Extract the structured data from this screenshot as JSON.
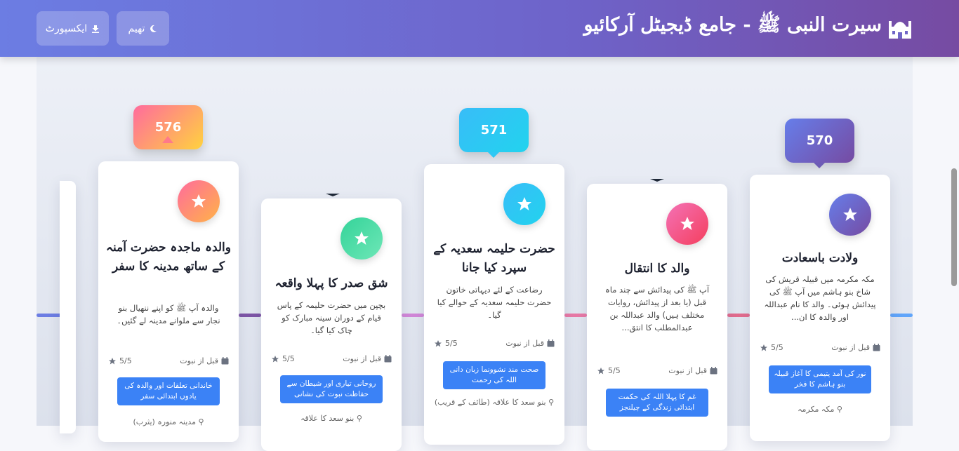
{
  "header": {
    "title": "سیرت النبی ﷺ - جامع ڈیجیٹل آرکائیو",
    "logo_icon": "mosque-icon",
    "export_label": "ایکسپورٹ",
    "theme_label": "تھیم",
    "gradient": [
      "#667eea",
      "#764ba2"
    ]
  },
  "timeline": {
    "cards": [
      {
        "year": "576",
        "title": "والدہ ماجدہ حضرت آمنہ کے ساتھ مدینہ کا سفر",
        "description": "والدہ آپ ﷺ کو اپنے ننھیال بنو نجار سے ملوانے مدینہ لے گئیں۔",
        "period": "قبل از نبوت",
        "rating": "5/5",
        "tag": "خاندانی تعلقات اور والدہ کی یادوں ابتدائی سفر",
        "location": "مدینہ منورہ (یثرب)"
      },
      {
        "year": "",
        "title": "شق صدر کا پہلا واقعہ",
        "description": "بچپن میں حضرت حلیمہ کے پاس قیام کے دوران سینہ مبارک کو چاک کیا گیا۔",
        "period": "قبل از نبوت",
        "rating": "5/5",
        "tag": "روحانی تیاری اور شیطان سے حفاظت نبوت کی نشانی",
        "location": "بنو سعد کا علاقہ"
      },
      {
        "year": "571",
        "title": "حضرت حلیمہ سعدیہ کے سپرد کیا جانا",
        "description": "رضاعت کے لئے دیہاتی خاتون حضرت حلیمہ سعدیہ کے حوالے کیا گیا۔",
        "period": "قبل از نبوت",
        "rating": "5/5",
        "tag": "صحت مند نشوونما زبان دانی اللہ کی رحمت",
        "location": "بنو سعد کا علاقہ (طائف کے قریب)"
      },
      {
        "year": "",
        "title": "والد کا انتقال",
        "description": "آپ ﷺ کی پیدائش سے چند ماہ قبل (یا بعد از پیدائش، روایات مختلف ہیں) والد عبداللہ بن عبدالمطلب کا انتق...",
        "period": "قبل از نبوت",
        "rating": "5/5",
        "tag": "غم کا پہلا اللہ کی حکمت ابتدائی زندگی کے چیلنجز",
        "location": ""
      },
      {
        "year": "570",
        "title": "ولادت باسعادت",
        "description": "مکہ مکرمہ میں قبیلہ قریش کی شاخ بنو ہاشم میں آپ ﷺ کی پیدائش ہوئی۔ والد کا نام عبداللہ اور والدہ کا ان...",
        "period": "قبل از نبوت",
        "rating": "5/5",
        "tag": "نور کی آمد یتیمی کا آغاز قبیلہ بنو ہاشم کا فخر",
        "location": "مکہ مکرمہ"
      }
    ]
  },
  "colors": {
    "card1": [
      "#ff6b9d",
      "#ffd23f"
    ],
    "card2": [
      "#34d399",
      "#6ee7b7"
    ],
    "card3": [
      "#38bdf8",
      "#22d3ee"
    ],
    "card4": [
      "#f472b6",
      "#f43f5e"
    ],
    "card5": [
      "#667eea",
      "#764ba2"
    ],
    "tag": "#3b82f6"
  }
}
